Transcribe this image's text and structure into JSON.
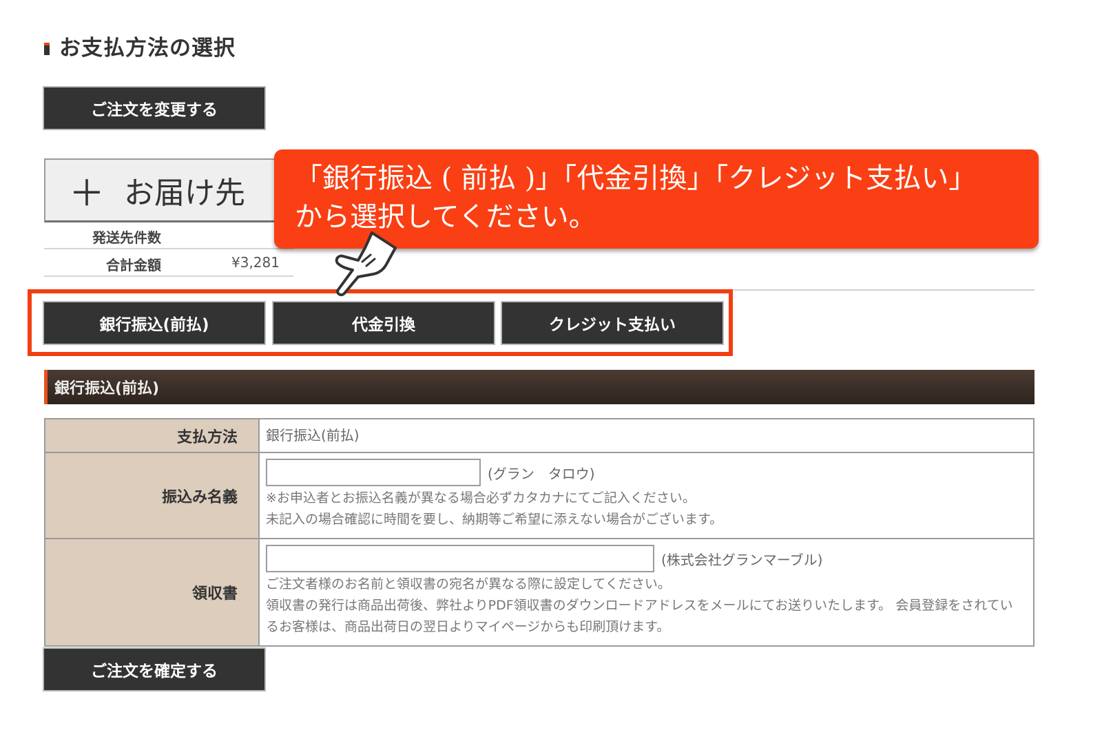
{
  "page": {
    "title": "お支払方法の選択"
  },
  "order": {
    "change_button": "ご注文を変更する",
    "confirm_button": "ご注文を確定する"
  },
  "delivery": {
    "plus": "＋",
    "label": "お届け先"
  },
  "summary": {
    "rows": [
      {
        "label": "発送先件数",
        "value": ""
      },
      {
        "label": "合計金額",
        "value": "¥3,281"
      }
    ]
  },
  "payment_tabs": [
    "銀行振込(前払)",
    "代金引換",
    "クレジット支払い"
  ],
  "section": {
    "title": "銀行振込(前払)"
  },
  "form": {
    "method": {
      "label": "支払方法",
      "value": "銀行振込(前払)"
    },
    "transfer_name": {
      "label": "振込み名義",
      "value": "",
      "hint": "(グラン　タロウ)",
      "notes": [
        "※お申込者とお振込名義が異なる場合必ずカタカナにてご記入ください。",
        "未記入の場合確認に時間を要し、納期等ご希望に添えない場合がございます。"
      ]
    },
    "receipt": {
      "label": "領収書",
      "value": "",
      "hint": "(株式会社グランマーブル)",
      "notes": [
        "ご注文者様のお名前と領収書の宛名が異なる際に設定してください。",
        "領収書の発行は商品出荷後、弊社よりPDF領収書のダウンロードアドレスをメールにてお送りいたします。 会員登録をされているお客様は、商品出荷日の翌日よりマイページからも印刷頂けます。"
      ]
    }
  },
  "callout": {
    "line1": "「銀行振込 ( 前払 )」「代金引換」「クレジット支払い」",
    "line2": "から選択してください。"
  },
  "colors": {
    "accent": "#f93f13",
    "button_bg": "#333333",
    "header_bg": "#3a2e26",
    "label_bg": "#dccdbd"
  }
}
